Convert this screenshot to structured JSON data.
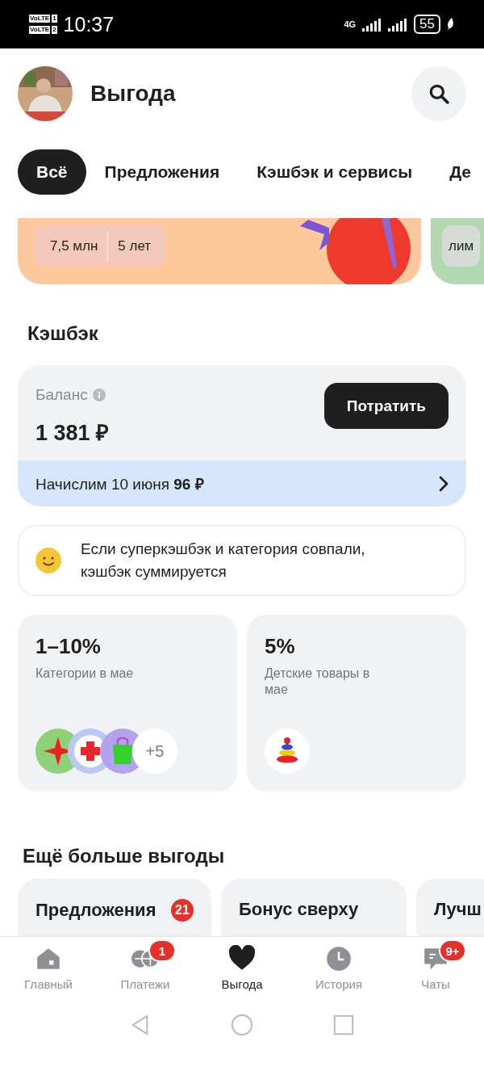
{
  "status_bar": {
    "sims": [
      {
        "label": "VoLTE",
        "slot": "1"
      },
      {
        "label": "VoLTE",
        "slot": "2"
      }
    ],
    "time": "10:37",
    "network": "4G",
    "battery": "55"
  },
  "header": {
    "title": "Выгода"
  },
  "tabs": [
    {
      "label": "Всё",
      "selected": true
    },
    {
      "label": "Предложения",
      "selected": false
    },
    {
      "label": "Кэшбэк и сервисы",
      "selected": false
    },
    {
      "label": "Де",
      "selected": false
    }
  ],
  "banners": [
    {
      "chips": [
        "7,5 млн",
        "5 лет"
      ],
      "color": "#fdc89c"
    },
    {
      "chips": [
        "лим"
      ],
      "color": "#b2d8b0"
    }
  ],
  "cashback": {
    "heading": "Кэшбэк",
    "balance_label": "Баланс",
    "balance": "1 381 ₽",
    "spend_button": "Потратить",
    "accrual": "Начислим 10 июня **96 ₽**"
  },
  "tip": {
    "text": "Если суперкэшбэк и категория совпали, кэшбэк суммируется"
  },
  "offers": [
    {
      "percent": "1–10%",
      "caption": "Категории в мае",
      "icons": [
        {
          "kind": "star"
        },
        {
          "kind": "cross"
        },
        {
          "kind": "bag"
        }
      ],
      "more": "+5"
    },
    {
      "percent": "5%",
      "caption": "Детские товары в мае",
      "icons": [
        {
          "kind": "pyramid"
        }
      ]
    }
  ],
  "more": {
    "heading": "Ещё больше выгоды",
    "cards": [
      {
        "title": "Предложения",
        "badge": "21"
      },
      {
        "title": "Бонус сверху"
      },
      {
        "title": "Лучш"
      }
    ]
  },
  "nav": [
    {
      "label": "Главный",
      "kind": "home",
      "selected": false
    },
    {
      "label": "Платежи",
      "kind": "payments",
      "selected": false,
      "badge": "1"
    },
    {
      "label": "Выгода",
      "kind": "heart",
      "selected": true
    },
    {
      "label": "История",
      "kind": "clock",
      "selected": false
    },
    {
      "label": "Чаты",
      "kind": "chat",
      "selected": false,
      "badge": "9+"
    }
  ]
}
